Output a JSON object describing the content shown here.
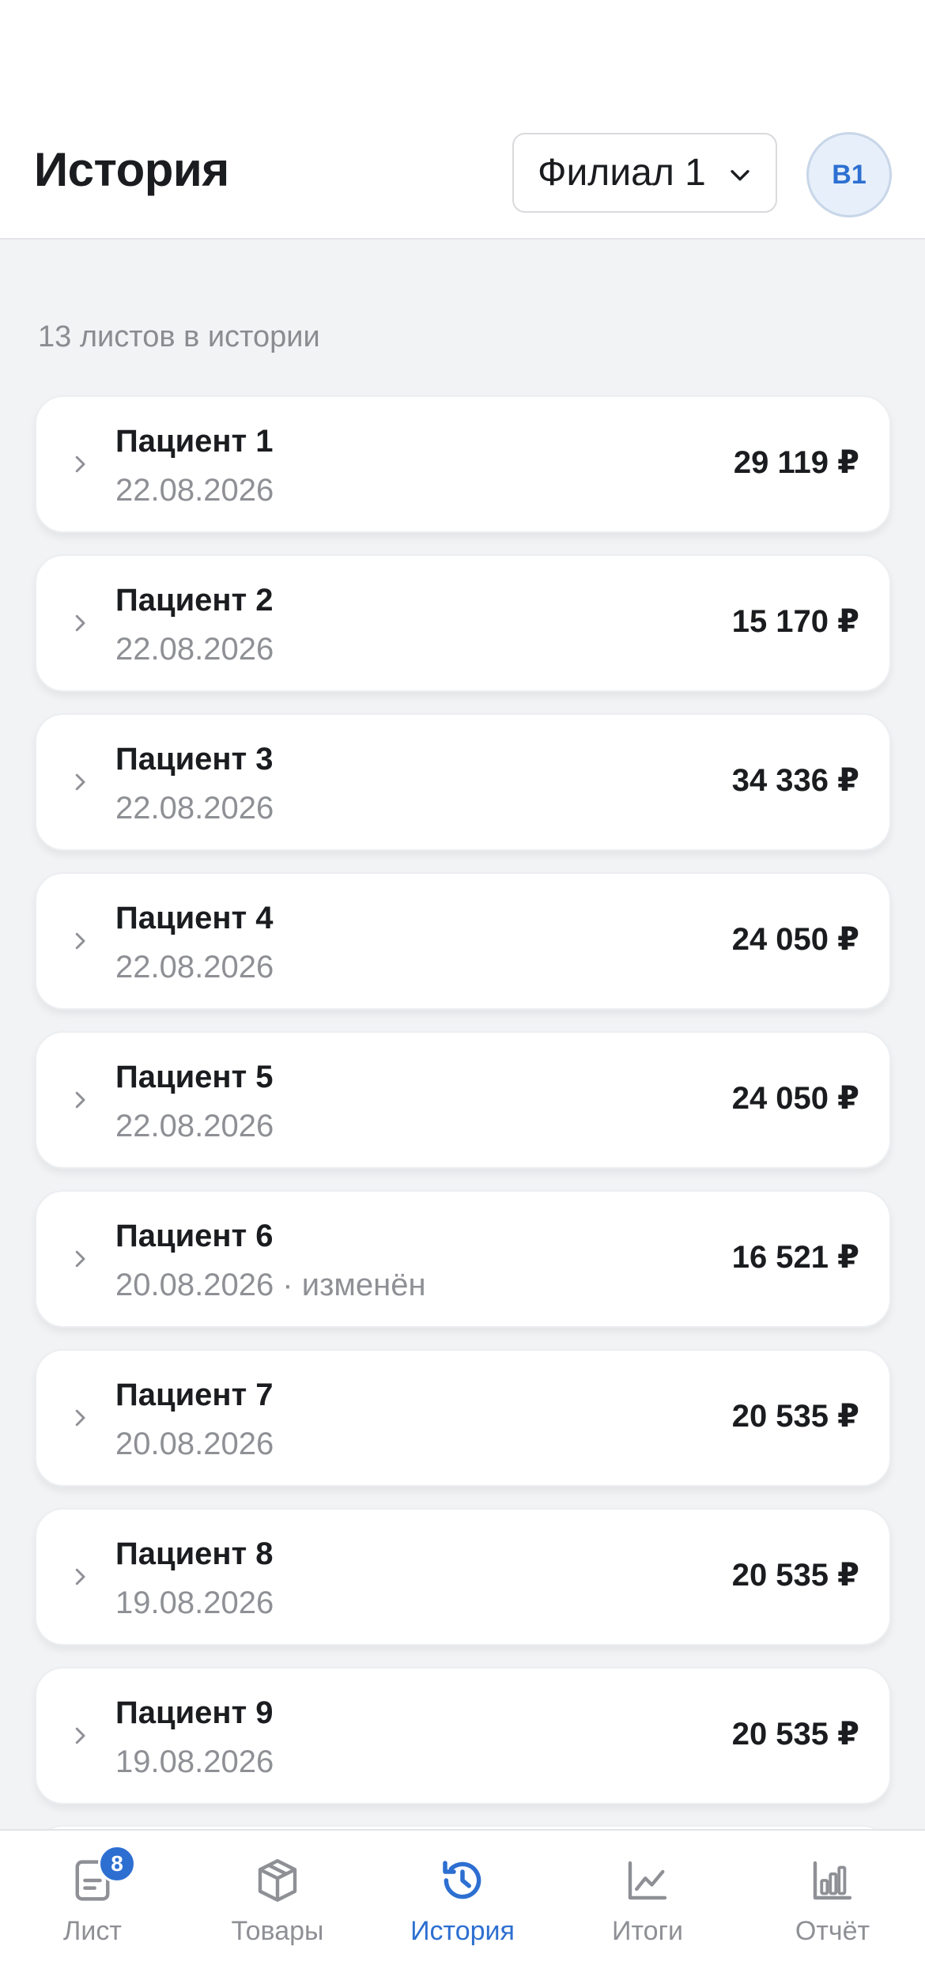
{
  "header": {
    "title": "История",
    "branch": "Филиал 1",
    "avatar_initials": "В1"
  },
  "history": {
    "count_text": "13 листов в истории",
    "items": [
      {
        "name": "Пациент 1",
        "date": "22.08.2026",
        "amount": "29 119 ₽"
      },
      {
        "name": "Пациент 2",
        "date": "22.08.2026",
        "amount": "15 170 ₽"
      },
      {
        "name": "Пациент 3",
        "date": "22.08.2026",
        "amount": "34 336 ₽"
      },
      {
        "name": "Пациент 4",
        "date": "22.08.2026",
        "amount": "24 050 ₽"
      },
      {
        "name": "Пациент 5",
        "date": "22.08.2026",
        "amount": "24 050 ₽"
      },
      {
        "name": "Пациент 6",
        "date": "20.08.2026 · изменён",
        "amount": "16 521 ₽"
      },
      {
        "name": "Пациент 7",
        "date": "20.08.2026",
        "amount": "20 535 ₽"
      },
      {
        "name": "Пациент 8",
        "date": "19.08.2026",
        "amount": "20 535 ₽"
      },
      {
        "name": "Пациент 9",
        "date": "19.08.2026",
        "amount": "20 535 ₽"
      }
    ]
  },
  "tabbar": {
    "items": [
      {
        "label": "Лист",
        "icon": "document-icon",
        "badge": "8",
        "active": false
      },
      {
        "label": "Товары",
        "icon": "box-icon",
        "active": false
      },
      {
        "label": "История",
        "icon": "history-clock-icon",
        "active": true
      },
      {
        "label": "Итоги",
        "icon": "line-chart-icon",
        "active": false
      },
      {
        "label": "Отчёт",
        "icon": "bar-chart-icon",
        "active": false
      }
    ]
  },
  "colors": {
    "accent": "#2d6fd1",
    "background": "#f2f3f5",
    "muted_text": "#8e9095"
  }
}
